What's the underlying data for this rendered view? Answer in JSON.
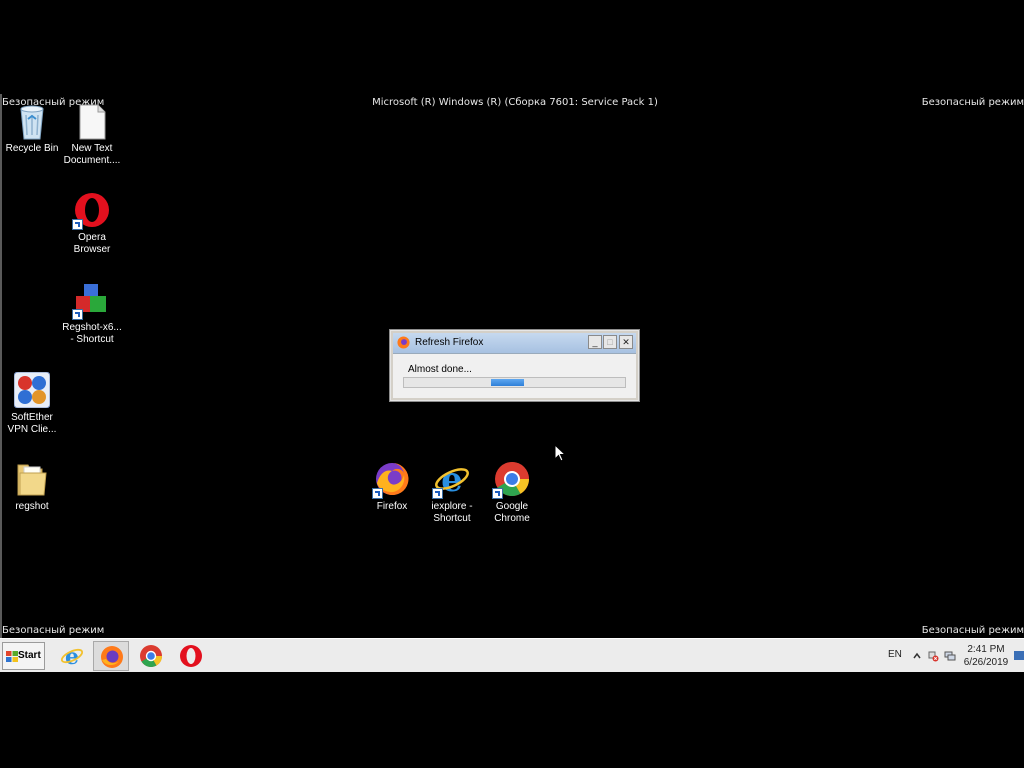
{
  "os": {
    "build_text": "Microsoft (R) Windows (R) (Сборка 7601: Service Pack 1)",
    "safe_mode_label": "Безопасный режим"
  },
  "desktop_icons": [
    {
      "id": "recycle-bin",
      "label": "Recycle Bin",
      "icon": "recycle-bin-icon"
    },
    {
      "id": "new-text-document",
      "label": "New Text Document....",
      "label_line1": "New Text",
      "label_line2": "Document....",
      "icon": "text-document-icon"
    },
    {
      "id": "opera",
      "label_line1": "Opera",
      "label_line2": "Browser",
      "icon": "opera-icon"
    },
    {
      "id": "regshot-shortcut",
      "label_line1": "Regshot-x6...",
      "label_line2": "- Shortcut",
      "icon": "regshot-icon"
    },
    {
      "id": "softether",
      "label_line1": "SoftEther",
      "label_line2": "VPN Clie...",
      "icon": "softether-icon"
    },
    {
      "id": "regshot-folder",
      "label": "regshot",
      "icon": "folder-icon"
    },
    {
      "id": "firefox",
      "label": "Firefox",
      "icon": "firefox-icon"
    },
    {
      "id": "iexplore",
      "label_line1": "iexplore -",
      "label_line2": "Shortcut",
      "icon": "internet-explorer-icon"
    },
    {
      "id": "chrome",
      "label_line1": "Google",
      "label_line2": "Chrome",
      "icon": "chrome-icon"
    }
  ],
  "dialog": {
    "title": "Refresh Firefox",
    "message": "Almost done...",
    "minimize": "_",
    "maximize": "□",
    "close": "✕",
    "progress": "indeterminate"
  },
  "taskbar": {
    "start_label": "Start",
    "pinned": [
      "internet-explorer-icon",
      "firefox-icon",
      "chrome-icon",
      "opera-icon"
    ],
    "active_app": "firefox"
  },
  "tray": {
    "language": "EN",
    "time": "2:41 PM",
    "date": "6/26/2019"
  },
  "colors": {
    "desktop_background": "#000000",
    "taskbar": "#ececec",
    "progress": "#3a8ae0"
  }
}
